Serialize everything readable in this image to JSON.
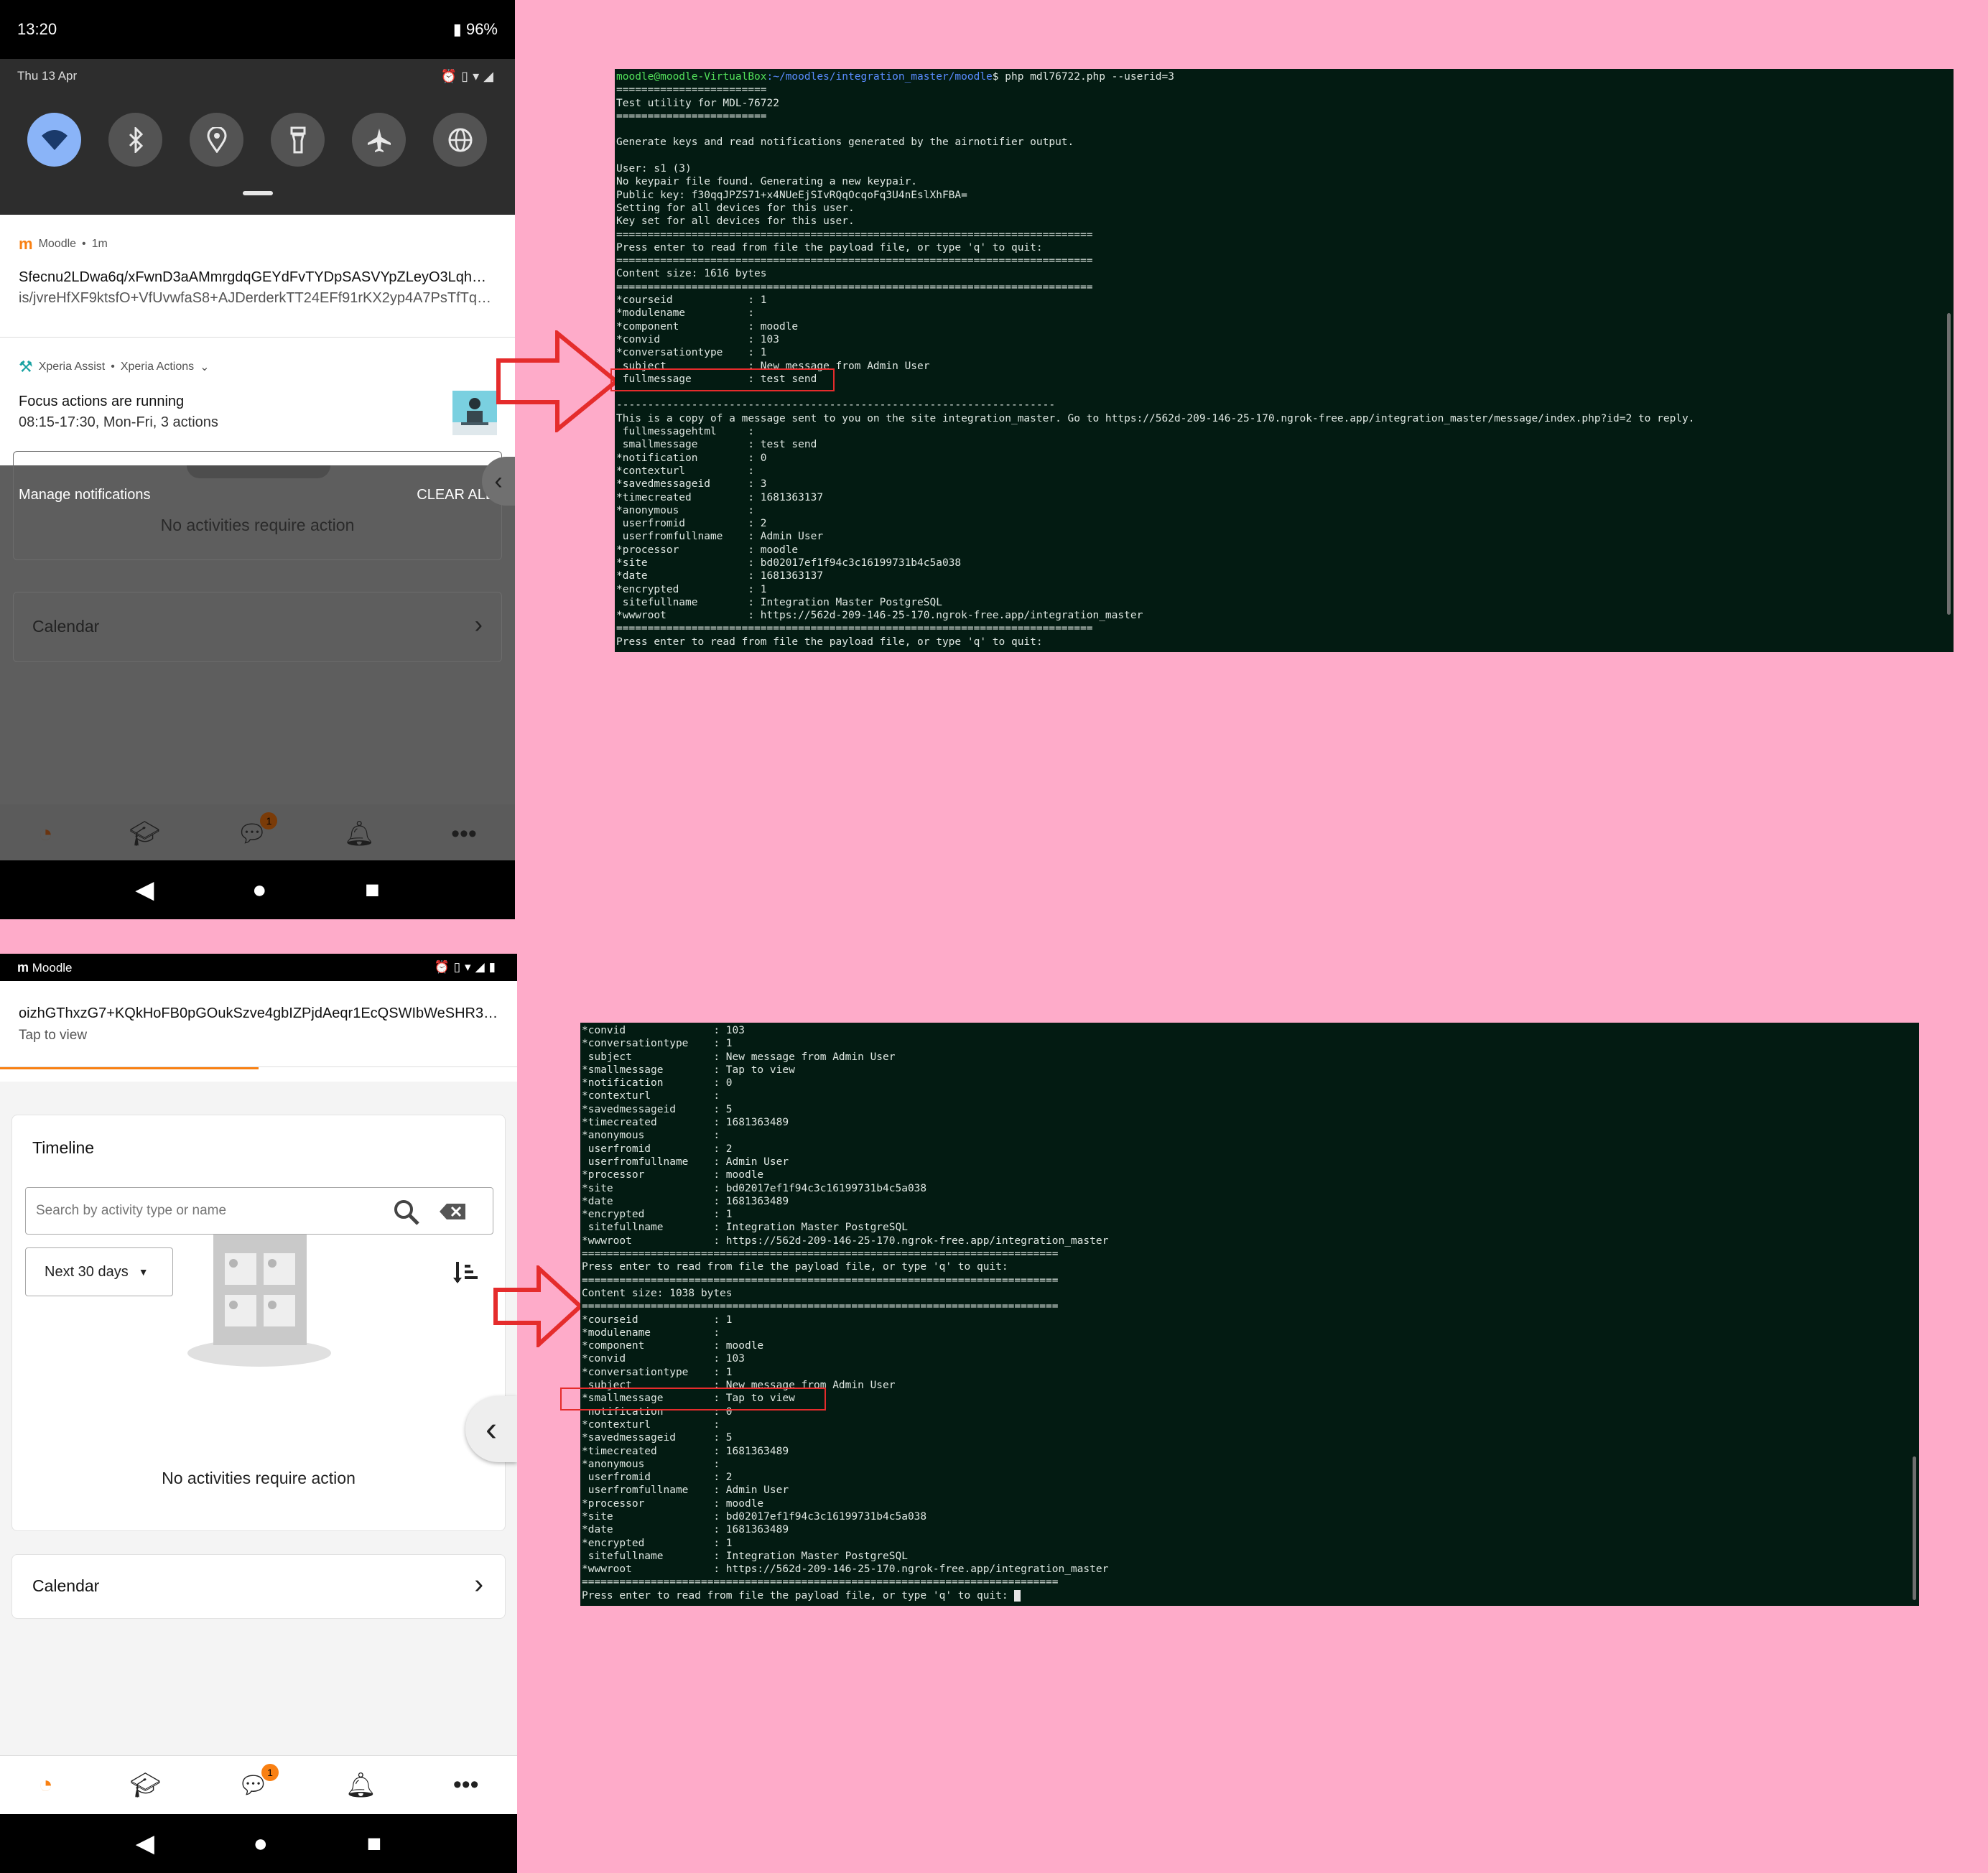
{
  "phone1": {
    "time": "13:20",
    "battery": "96%",
    "date": "Thu 13 Apr",
    "quick_tiles": [
      "wifi-icon",
      "bluetooth-icon",
      "location-icon",
      "flashlight-icon",
      "airplane-icon",
      "globe-icon"
    ],
    "moodle_notification": {
      "app": "Moodle",
      "age": "1m",
      "title": "Sfecnu2LDwa6q/xFwnD3aAMmrgdqGEYdFvTYDpSASVYpZLeyO3LqhGfa…",
      "body": "is/jvreHfXF9ktsfO+VfUvwfaS8+AJDerderkTT24EFf91rKX2yp4A7PsTfTqzL…"
    },
    "xperia_notification": {
      "app": "Xperia Assist",
      "channel": "Xperia Actions",
      "title": "Focus actions are running",
      "body": "08:15-17:30, Mon-Fri, 3 actions"
    },
    "manage_label": "Manage notifications",
    "clear_label": "CLEAR ALL",
    "empty_text": "No activities require action",
    "calendar_label": "Calendar",
    "messages_badge": "1"
  },
  "phone2": {
    "app": "Moodle",
    "notification_title": "oizhGThxzG7+KQkHoFB0pGOukSzve4gbIZPjdAeqr1EcQSWIbWeSHR3m4…",
    "notification_sub": "Tap to view",
    "timeline_title": "Timeline",
    "search_placeholder": "Search by activity type or name",
    "filter_label": "Next 30 days",
    "empty_text": "No activities require action",
    "calendar_label": "Calendar",
    "messages_badge": "1"
  },
  "terminal1": {
    "prompt_user": "moodle@moodle-VirtualBox",
    "prompt_path": ":~/moodles/integration_master/moodle",
    "command": "$ php mdl76722.php --userid=3",
    "output": "========================\nTest utility for MDL-76722\n========================\n\nGenerate keys and read notifications generated by the airnotifier output.\n\nUser: s1 (3)\nNo keypair file found. Generating a new keypair.\nPublic key: f30qqJPZS71+x4NUeEjSIvRQqOcqoFq3U4nEslXhFBA=\nSetting for all devices for this user.\nKey set for all devices for this user.\n============================================================================\nPress enter to read from file the payload file, or type 'q' to quit:\n============================================================================\nContent size: 1616 bytes\n============================================================================\n*courseid            : 1\n*modulename          :\n*component           : moodle\n*convid              : 103\n*conversationtype    : 1\n subject             : New message from Admin User\n fullmessage         : test send\n\n----------------------------------------------------------------------\nThis is a copy of a message sent to you on the site integration_master. Go to https://562d-209-146-25-170.ngrok-free.app/integration_master/message/index.php?id=2 to reply.\n fullmessagehtml     :\n smallmessage        : test send\n*notification        : 0\n*contexturl          :\n*savedmessageid      : 3\n*timecreated         : 1681363137\n*anonymous           :\n userfromid          : 2\n userfromfullname    : Admin User\n*processor           : moodle\n*site                : bd02017ef1f94c3c16199731b4c5a038\n*date                : 1681363137\n*encrypted           : 1\n sitefullname        : Integration Master PostgreSQL\n*wwwroot             : https://562d-209-146-25-170.ngrok-free.app/integration_master\n============================================================================\nPress enter to read from file the payload file, or type 'q' to quit:"
  },
  "terminal2": {
    "output": "*convid              : 103\n*conversationtype    : 1\n subject             : New message from Admin User\n*smallmessage        : Tap to view\n*notification        : 0\n*contexturl          :\n*savedmessageid      : 5\n*timecreated         : 1681363489\n*anonymous           :\n userfromid          : 2\n userfromfullname    : Admin User\n*processor           : moodle\n*site                : bd02017ef1f94c3c16199731b4c5a038\n*date                : 1681363489\n*encrypted           : 1\n sitefullname        : Integration Master PostgreSQL\n*wwwroot             : https://562d-209-146-25-170.ngrok-free.app/integration_master\n============================================================================\nPress enter to read from file the payload file, or type 'q' to quit:\n============================================================================\nContent size: 1038 bytes\n============================================================================\n*courseid            : 1\n*modulename          :\n*component           : moodle\n*convid              : 103\n*conversationtype    : 1\n subject             : New message from Admin User\n*smallmessage        : Tap to view\n notification        : 0\n*contexturl          :\n*savedmessageid      : 5\n*timecreated         : 1681363489\n*anonymous           :\n userfromid          : 2\n userfromfullname    : Admin User\n*processor           : moodle\n*site                : bd02017ef1f94c3c16199731b4c5a038\n*date                : 1681363489\n*encrypted           : 1\n sitefullname        : Integration Master PostgreSQL\n*wwwroot             : https://562d-209-146-25-170.ngrok-free.app/integration_master\n============================================================================\nPress enter to read from file the payload file, or type 'q' to quit: "
  },
  "colors": {
    "background": "#feabc9",
    "terminal_bg": "#031b12",
    "moodle_orange": "#f98012",
    "highlight_red": "#e52c2c"
  }
}
